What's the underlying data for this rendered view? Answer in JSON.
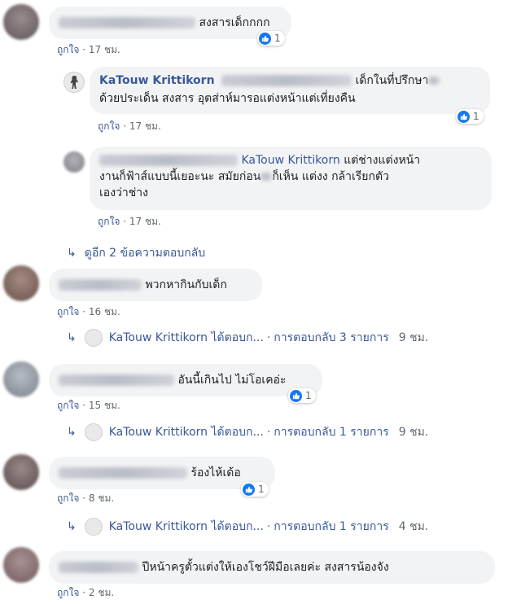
{
  "like_label": "ถูกใจ",
  "c1": {
    "text": "สงสารเด็กกกก",
    "time": "17 ชม.",
    "likes": "1"
  },
  "r1": {
    "author": "KaTouw Krittikorn",
    "text_a": "เด็กในที่ปรึกษา",
    "text_b": "ด้วยประเด็น สงสาร อุตส่าห์มารอแต่งหน้าแต่เที่ยงคืน",
    "time": "17 ชม.",
    "likes": "1"
  },
  "r2": {
    "mention": "KaTouw Krittikorn",
    "text_a": "แต่ช่างแต่งหน้า",
    "text_b1": "งานก็ฟ้าส์แบบนี้เยอะนะ สมัยก่อน",
    "text_b2": "ก็เห็น แต่งง กล้าเรียกตัว",
    "text_c": "เองว่าช่าง",
    "time": "17 ชม."
  },
  "more_replies": "ดูอีก 2 ข้อความตอบกลับ",
  "c2": {
    "text": "พวกหากินกับเด็ก",
    "time": "16 ชม.",
    "reply": {
      "author": "KaTouw Krittikorn",
      "action": "ได้ตอบก...",
      "count": "การตอบกลับ 3 รายการ",
      "time": "9 ชม."
    }
  },
  "c3": {
    "text": "อันนี้เกินไป ไม่โอเคอ่ะ",
    "time": "15 ชม.",
    "likes": "1",
    "reply": {
      "author": "KaTouw Krittikorn",
      "action": "ได้ตอบก...",
      "count": "การตอบกลับ 1 รายการ",
      "time": "9 ชม."
    }
  },
  "c4": {
    "text": "ร้องไห้เด้อ",
    "time": "8 ชม.",
    "likes": "1",
    "reply": {
      "author": "KaTouw Krittikorn",
      "action": "ได้ตอบก...",
      "count": "การตอบกลับ 1 รายการ",
      "time": "4 ชม."
    }
  },
  "c5": {
    "text": "ปีหน้าครูตั้วแต่งให้เองโชว์ฝีมือเลยค่ะ สงสารน้องจัง",
    "time": "2 ชม."
  },
  "icons": {
    "like": "like-thumb-icon",
    "reply_arrow": "reply-arrow-icon",
    "avatar": "avatar"
  }
}
